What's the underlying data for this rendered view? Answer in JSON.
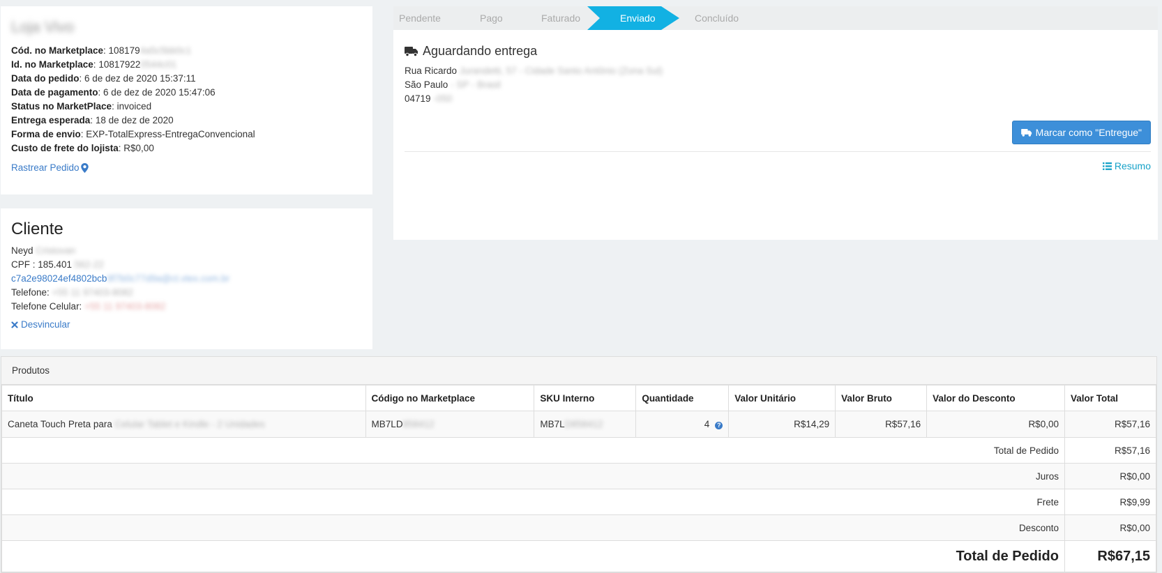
{
  "store": {
    "name": "Loja Vivo",
    "fields": [
      {
        "label": "Cód. no Marketplace",
        "value": "108179",
        "hidden": "4a5c5bb0c1"
      },
      {
        "label": "Id. no Marketplace",
        "value": "10817922",
        "hidden": "0544c01"
      },
      {
        "label": "Data do pedido",
        "value": "6 de dez de 2020 15:37:11",
        "hidden": ""
      },
      {
        "label": "Data de pagamento",
        "value": "6 de dez de 2020 15:47:06",
        "hidden": ""
      },
      {
        "label": "Status no MarketPlace",
        "value": "invoiced",
        "hidden": ""
      },
      {
        "label": "Entrega esperada",
        "value": "18 de dez de 2020",
        "hidden": ""
      },
      {
        "label": "Forma de envio",
        "value": "EXP-TotalExpress-EntregaConvencional",
        "hidden": ""
      },
      {
        "label": "Custo de frete do lojista",
        "value": "R$0,00",
        "hidden": ""
      }
    ],
    "track_link": "Rastrear Pedido"
  },
  "client": {
    "title": "Cliente",
    "name": "Neyd",
    "name_hidden": "Cristovan",
    "cpf_label": "CPF : 185.401",
    "cpf_hidden": ".562-22",
    "email": "c7a2e98024ef4802bcb",
    "email_hidden": "9f7b0c77d9a@ct.vtex.com.br",
    "phone_label": "Telefone:",
    "phone_hidden": "+55 11 97403-8082",
    "mobile_label": "Telefone Celular:",
    "mobile_hidden": "+55 11 97403-8082",
    "unlink": "Desvincular"
  },
  "status": {
    "steps": [
      "Pendente",
      "Pago",
      "Faturado",
      "Enviado",
      "Concluído"
    ],
    "active_step": 3,
    "active_color": "#12b1e3",
    "delivery_title": "Aguardando entrega",
    "address": [
      {
        "value": "Rua Ricardo",
        "hidden": "Jurandetti, 57 - Cidade Santo Antônio (Zona Sul)"
      },
      {
        "value": "São Paulo",
        "hidden": "- SP - Brasil"
      },
      {
        "value": "04719",
        "hidden": "-050"
      }
    ],
    "mark_button": "Marcar como \"Entregue\"",
    "resume_link": "Resumo"
  },
  "products": {
    "header": "Produtos",
    "columns": [
      "Título",
      "Código no Marketplace",
      "SKU Interno",
      "Quantidade",
      "Valor Unitário",
      "Valor Bruto",
      "Valor do Desconto",
      "Valor Total"
    ],
    "rows": [
      {
        "title": "Caneta Touch Preta para",
        "title_hidden": "Celular Tablet e Kindle - 2 Unidades",
        "code": "MB7LD",
        "code_hidden": "858412",
        "sku": "MB7L",
        "sku_hidden": "D858412",
        "qty": "4",
        "unit": "R$14,29",
        "gross": "R$57,16",
        "discount": "R$0,00",
        "total": "R$57,16"
      }
    ],
    "summary": [
      {
        "label": "Total de Pedido",
        "value": "R$57,16"
      },
      {
        "label": "Juros",
        "value": "R$0,00"
      },
      {
        "label": "Frete",
        "value": "R$9,99"
      },
      {
        "label": "Desconto",
        "value": "R$0,00"
      }
    ],
    "grand_total": {
      "label": "Total de Pedido",
      "value": "R$67,15"
    }
  }
}
